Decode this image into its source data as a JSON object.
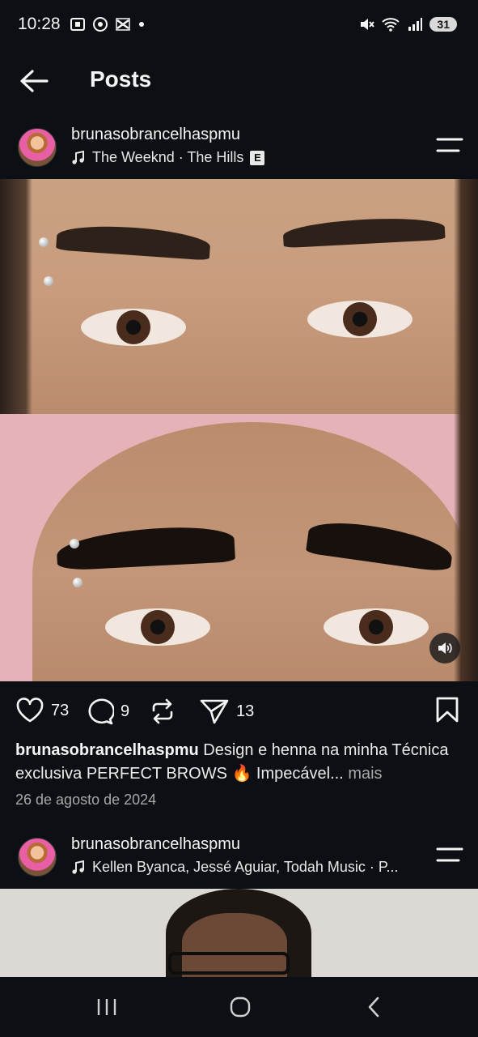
{
  "status_bar": {
    "time": "10:28",
    "battery": "31"
  },
  "header": {
    "title": "Posts"
  },
  "posts": [
    {
      "username": "brunasobrancelhaspmu",
      "music": "The Weeknd · The Hills",
      "explicit_badge": "E",
      "likes": "73",
      "comments": "9",
      "shares": "13",
      "caption_user": "brunasobrancelhaspmu",
      "caption_text": " Design e henna na minha Técnica exclusiva PERFECT BROWS 🔥 Impecável... ",
      "caption_more": "mais",
      "date": "26 de agosto de 2024"
    },
    {
      "username": "brunasobrancelhaspmu",
      "music": "Kellen Byanca, Jessé Aguiar, Todah Music · P..."
    }
  ],
  "colors": {
    "background": "#0c1014",
    "text": "#f5f5f5",
    "muted": "#a8a8a8"
  },
  "icons": {
    "back": "arrow-left-icon",
    "menu": "menu-lines-icon",
    "like": "heart-icon",
    "comment": "comment-icon",
    "repost": "repost-icon",
    "share": "send-icon",
    "save": "bookmark-icon",
    "sound": "speaker-icon"
  }
}
